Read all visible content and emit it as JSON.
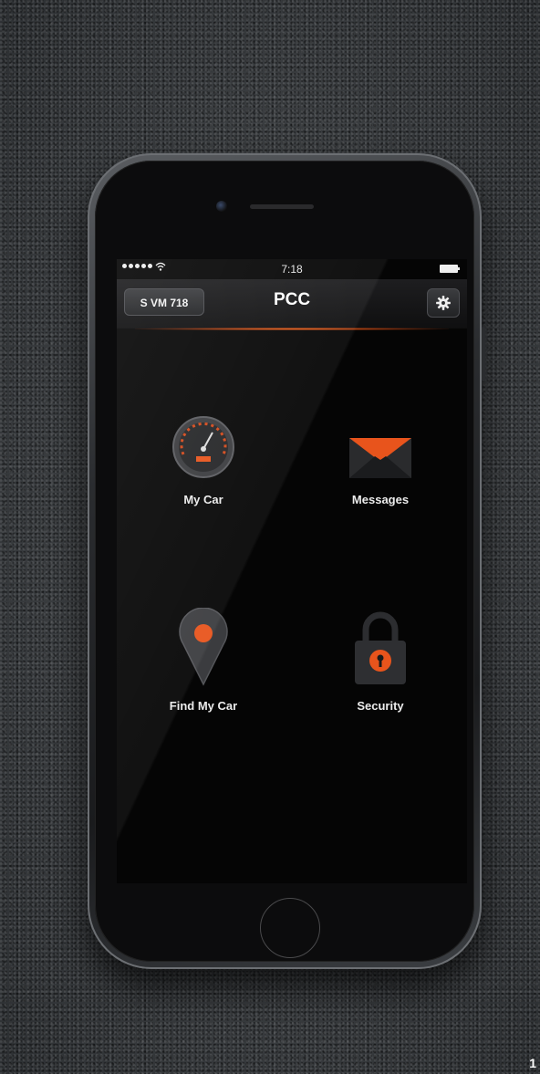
{
  "status_bar": {
    "time": "7:18"
  },
  "nav": {
    "plate_label": "S VM 718",
    "title": "PCC"
  },
  "menu": [
    {
      "label": "My Car",
      "icon": "speedometer-icon"
    },
    {
      "label": "Messages",
      "icon": "envelope-icon"
    },
    {
      "label": "Find My Car",
      "icon": "map-pin-icon"
    },
    {
      "label": "Security",
      "icon": "padlock-icon"
    }
  ],
  "figure_number": "1",
  "colors": {
    "accent": "#e8541c",
    "screen_bg": "#050505"
  }
}
